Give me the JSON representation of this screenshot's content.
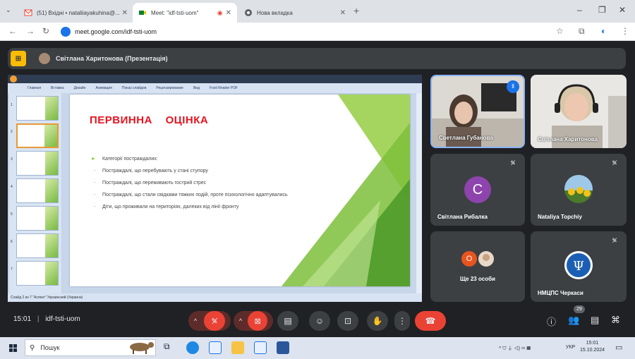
{
  "browser": {
    "tabs": [
      {
        "title": "(51) Вхідні • nataliiayakuhina@...",
        "favicon": "gmail-icon"
      },
      {
        "title": "Meet: \"idf-tsti-uom\"",
        "favicon": "meet-icon"
      },
      {
        "title": "Нова вкладка",
        "favicon": "chrome-icon"
      }
    ],
    "url": "meet.google.com/idf-tsti-uom"
  },
  "meet": {
    "presenter_label": "Світлана Харитонова (Презентація)",
    "meeting_code": "idf-tsti-uom",
    "time": "15:01",
    "participants_badge": "29"
  },
  "presentation": {
    "ribbon_tabs": [
      "Главная",
      "Вставка",
      "Дизайн",
      "Анимация",
      "Показ слайдов",
      "Рецензирование",
      "Вид",
      "Foxit Reader PDF"
    ],
    "status_text": "Слайд 2 из 7    \"Аспект\"    Украинский (Украина)",
    "slide": {
      "title": "ПЕРВИННА    ОЦІНКА",
      "bullets": [
        {
          "text": "Категорії постраждалих:",
          "level": 1
        },
        {
          "text": "Постраждалі, що перебувають у  стані ступору",
          "level": 2
        },
        {
          "text": "Постраждалі, що переживають гострий стрес",
          "level": 2
        },
        {
          "text": "Постраждалі, що стали свідками тяжких подій, проте психологічно адаптувались",
          "level": 2
        },
        {
          "text": "Діти, що проживали на територіях, далеких від лінії фронту",
          "level": 2
        }
      ]
    }
  },
  "tiles": {
    "t1": {
      "name": "Светлана Губанова"
    },
    "t2": {
      "name": "Світлана Харитонова"
    },
    "t3": {
      "name": "Світлана Рибалка",
      "initial": "C"
    },
    "t4": {
      "name": "Nataliya Topchiy"
    },
    "t5": {
      "name": "Ще 23 особи",
      "initial": "O"
    },
    "t6": {
      "name": "НМЦПС Черкаси"
    }
  },
  "taskbar": {
    "search_placeholder": "Пошук",
    "language": "УКР",
    "clock_time": "15:01",
    "clock_date": "15.10.2024"
  },
  "colors": {
    "accent_red": "#ea4335",
    "slide_title": "#e8131f",
    "slide_green": "#8fc33b"
  }
}
